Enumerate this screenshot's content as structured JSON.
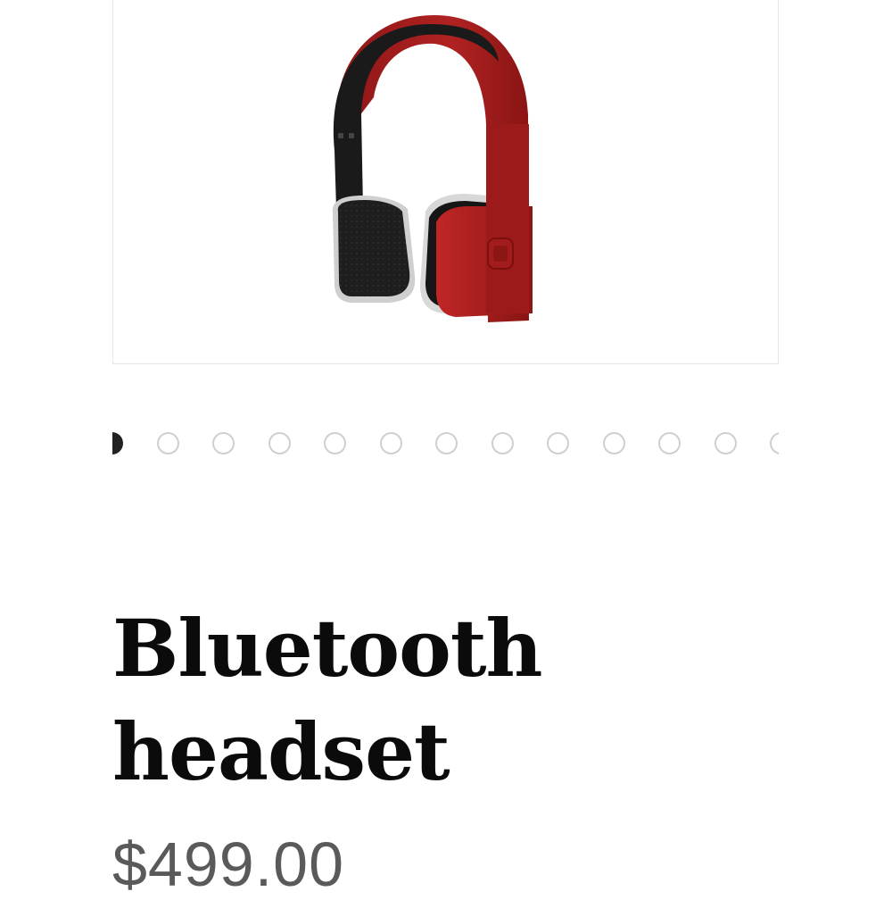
{
  "product": {
    "name": "Bluetooth headset",
    "price": "$499.00",
    "image_icon": "headphones-image",
    "colors": {
      "body": "#a61d1d",
      "cushion": "#1c1c1c"
    }
  },
  "carousel": {
    "dot_count": 13,
    "active_index": 0
  }
}
